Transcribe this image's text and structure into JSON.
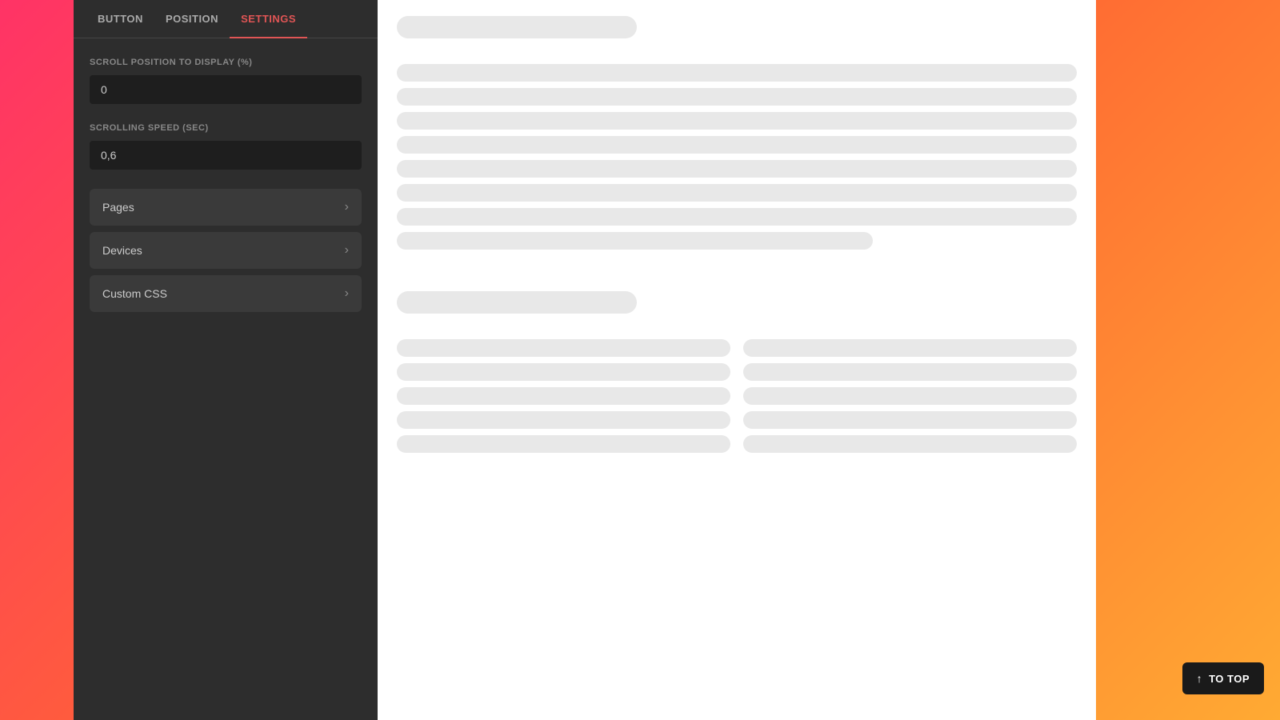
{
  "tabs": {
    "items": [
      {
        "id": "button",
        "label": "BUTTON"
      },
      {
        "id": "position",
        "label": "POSITION"
      },
      {
        "id": "settings",
        "label": "SETTINGS"
      }
    ],
    "active": "settings"
  },
  "settings": {
    "scroll_position_label": "SCROLL POSITION TO DISPLAY (%)",
    "scroll_position_value": "0",
    "scrolling_speed_label": "SCROLLING SPEED (SEC)",
    "scrolling_speed_value": "0,6"
  },
  "accordion": {
    "items": [
      {
        "id": "pages",
        "label": "Pages"
      },
      {
        "id": "devices",
        "label": "Devices"
      },
      {
        "id": "custom_css",
        "label": "Custom CSS"
      }
    ]
  },
  "to_top_button": {
    "label": "TO TOP",
    "arrow": "↑"
  }
}
